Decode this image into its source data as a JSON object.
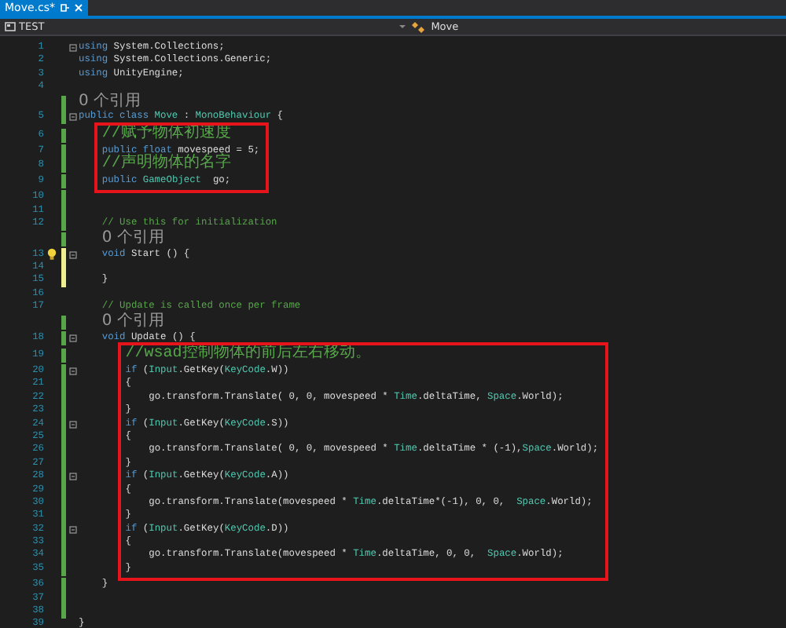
{
  "tabs": [
    {
      "label": "Move.cs*",
      "selected": true
    }
  ],
  "navbar": {
    "project": "TEST",
    "class_name": "Move"
  },
  "blocks": [
    {
      "kind": "plain",
      "lines": [
        {
          "kind": "code",
          "number": "1",
          "fold": true,
          "bulb": false,
          "changed": false,
          "unsaved": false,
          "tokens": [
            {
              "kind": "keyword",
              "text": "using"
            },
            {
              "kind": "plain",
              "text": " System.Collections;"
            }
          ]
        },
        {
          "kind": "code",
          "number": "2",
          "fold": false,
          "bulb": false,
          "changed": false,
          "unsaved": false,
          "tokens": [
            {
              "kind": "keyword",
              "text": "using"
            },
            {
              "kind": "plain",
              "text": " System.Collections.Generic;"
            }
          ]
        },
        {
          "kind": "code",
          "number": "3",
          "fold": false,
          "bulb": false,
          "changed": false,
          "unsaved": false,
          "tokens": [
            {
              "kind": "keyword",
              "text": "using"
            },
            {
              "kind": "plain",
              "text": " UnityEngine;"
            }
          ]
        },
        {
          "kind": "code",
          "number": "4",
          "fold": false,
          "bulb": false,
          "changed": false,
          "unsaved": false
        },
        {
          "kind": "codelens",
          "changed": true,
          "unsaved": false,
          "text": "0 个引用"
        },
        {
          "kind": "code",
          "number": "5",
          "fold": true,
          "bulb": false,
          "changed": true,
          "unsaved": false,
          "tokens": [
            {
              "kind": "keyword",
              "text": "public class "
            },
            {
              "kind": "type",
              "text": "Move"
            },
            {
              "kind": "plain",
              "text": " : "
            },
            {
              "kind": "type",
              "text": "MonoBehaviour"
            },
            {
              "kind": "plain",
              "text": " {"
            }
          ]
        }
      ]
    },
    {
      "kind": "boxed",
      "lines": [
        {
          "kind": "code",
          "number": "6",
          "fold": false,
          "bulb": false,
          "changed": true,
          "unsaved": false,
          "tokens": [
            {
              "kind": "comment",
              "text": "    //赋予物体初速度"
            }
          ]
        },
        {
          "kind": "code",
          "number": "7",
          "fold": false,
          "bulb": false,
          "changed": true,
          "unsaved": false,
          "tokens": [
            {
              "kind": "keyword",
              "text": "    public float"
            },
            {
              "kind": "plain",
              "text": " movespeed = 5;"
            }
          ]
        },
        {
          "kind": "code",
          "number": "8",
          "fold": false,
          "bulb": false,
          "changed": true,
          "unsaved": false,
          "tokens": [
            {
              "kind": "comment",
              "text": "    //声明物体的名字"
            }
          ]
        },
        {
          "kind": "code",
          "number": "9",
          "fold": false,
          "bulb": false,
          "changed": true,
          "unsaved": false,
          "tokens": [
            {
              "kind": "keyword",
              "text": "    public "
            },
            {
              "kind": "type",
              "text": "GameObject"
            },
            {
              "kind": "plain",
              "text": "  go;"
            }
          ]
        }
      ]
    },
    {
      "kind": "plain",
      "lines": [
        {
          "kind": "code",
          "number": "10",
          "fold": false,
          "bulb": false,
          "changed": true,
          "unsaved": false
        },
        {
          "kind": "code",
          "number": "11",
          "fold": false,
          "bulb": false,
          "changed": true,
          "unsaved": false
        },
        {
          "kind": "code",
          "number": "12",
          "fold": false,
          "bulb": false,
          "changed": true,
          "unsaved": false,
          "tokens": [
            {
              "kind": "comment",
              "text": "    // Use this for initialization"
            }
          ]
        },
        {
          "kind": "codelens",
          "changed": true,
          "unsaved": false,
          "text": "    0 个引用"
        },
        {
          "kind": "code",
          "number": "13",
          "fold": true,
          "bulb": true,
          "changed": true,
          "unsaved": true,
          "tokens": [
            {
              "kind": "keyword",
              "text": "    void"
            },
            {
              "kind": "plain",
              "text": " Start () {"
            }
          ]
        },
        {
          "kind": "code",
          "number": "14",
          "fold": false,
          "bulb": false,
          "changed": true,
          "unsaved": true
        },
        {
          "kind": "code",
          "number": "15",
          "fold": false,
          "bulb": false,
          "changed": true,
          "unsaved": true,
          "tokens": [
            {
              "kind": "plain",
              "text": "    }"
            }
          ]
        },
        {
          "kind": "code",
          "number": "16",
          "fold": false,
          "bulb": false,
          "changed": false,
          "unsaved": false
        },
        {
          "kind": "code",
          "number": "17",
          "fold": false,
          "bulb": false,
          "changed": false,
          "unsaved": false,
          "tokens": [
            {
              "kind": "comment",
              "text": "    // Update is called once per frame"
            }
          ]
        },
        {
          "kind": "codelens",
          "changed": true,
          "unsaved": false,
          "text": "    0 个引用"
        },
        {
          "kind": "code",
          "number": "18",
          "fold": true,
          "bulb": false,
          "changed": true,
          "unsaved": false,
          "tokens": [
            {
              "kind": "keyword",
              "text": "    void"
            },
            {
              "kind": "plain",
              "text": " Update () {"
            }
          ]
        }
      ]
    },
    {
      "kind": "boxed",
      "lines": [
        {
          "kind": "code",
          "number": "19",
          "fold": false,
          "bulb": false,
          "changed": true,
          "unsaved": false,
          "tokens": [
            {
              "kind": "comment",
              "text": "        //wsad控制物体的前后左右移动。"
            }
          ]
        },
        {
          "kind": "code",
          "number": "20",
          "fold": true,
          "bulb": false,
          "changed": true,
          "unsaved": false,
          "tokens": [
            {
              "kind": "keyword",
              "text": "        if"
            },
            {
              "kind": "plain",
              "text": " ("
            },
            {
              "kind": "type",
              "text": "Input"
            },
            {
              "kind": "plain",
              "text": ".GetKey("
            },
            {
              "kind": "type",
              "text": "KeyCode"
            },
            {
              "kind": "plain",
              "text": ".W))"
            }
          ]
        },
        {
          "kind": "code",
          "number": "21",
          "fold": false,
          "bulb": false,
          "changed": true,
          "unsaved": false,
          "tokens": [
            {
              "kind": "plain",
              "text": "        {"
            }
          ]
        },
        {
          "kind": "code",
          "number": "22",
          "fold": false,
          "bulb": false,
          "changed": true,
          "unsaved": false,
          "tokens": [
            {
              "kind": "plain",
              "text": "            go.transform.Translate( 0, 0, movespeed * "
            },
            {
              "kind": "type",
              "text": "Time"
            },
            {
              "kind": "plain",
              "text": ".deltaTime, "
            },
            {
              "kind": "type",
              "text": "Space"
            },
            {
              "kind": "plain",
              "text": ".World);"
            }
          ]
        },
        {
          "kind": "code",
          "number": "23",
          "fold": false,
          "bulb": false,
          "changed": true,
          "unsaved": false,
          "tokens": [
            {
              "kind": "plain",
              "text": "        }"
            }
          ]
        },
        {
          "kind": "code",
          "number": "24",
          "fold": true,
          "bulb": false,
          "changed": true,
          "unsaved": false,
          "tokens": [
            {
              "kind": "keyword",
              "text": "        if"
            },
            {
              "kind": "plain",
              "text": " ("
            },
            {
              "kind": "type",
              "text": "Input"
            },
            {
              "kind": "plain",
              "text": ".GetKey("
            },
            {
              "kind": "type",
              "text": "KeyCode"
            },
            {
              "kind": "plain",
              "text": ".S))"
            }
          ]
        },
        {
          "kind": "code",
          "number": "25",
          "fold": false,
          "bulb": false,
          "changed": true,
          "unsaved": false,
          "tokens": [
            {
              "kind": "plain",
              "text": "        {"
            }
          ]
        },
        {
          "kind": "code",
          "number": "26",
          "fold": false,
          "bulb": false,
          "changed": true,
          "unsaved": false,
          "tokens": [
            {
              "kind": "plain",
              "text": "            go.transform.Translate( 0, 0, movespeed * "
            },
            {
              "kind": "type",
              "text": "Time"
            },
            {
              "kind": "plain",
              "text": ".deltaTime * (-1),"
            },
            {
              "kind": "type",
              "text": "Space"
            },
            {
              "kind": "plain",
              "text": ".World);"
            }
          ]
        },
        {
          "kind": "code",
          "number": "27",
          "fold": false,
          "bulb": false,
          "changed": true,
          "unsaved": false,
          "tokens": [
            {
              "kind": "plain",
              "text": "        }"
            }
          ]
        },
        {
          "kind": "code",
          "number": "28",
          "fold": true,
          "bulb": false,
          "changed": true,
          "unsaved": false,
          "tokens": [
            {
              "kind": "keyword",
              "text": "        if"
            },
            {
              "kind": "plain",
              "text": " ("
            },
            {
              "kind": "type",
              "text": "Input"
            },
            {
              "kind": "plain",
              "text": ".GetKey("
            },
            {
              "kind": "type",
              "text": "KeyCode"
            },
            {
              "kind": "plain",
              "text": ".A))"
            }
          ]
        },
        {
          "kind": "code",
          "number": "29",
          "fold": false,
          "bulb": false,
          "changed": true,
          "unsaved": false,
          "tokens": [
            {
              "kind": "plain",
              "text": "        {"
            }
          ]
        },
        {
          "kind": "code",
          "number": "30",
          "fold": false,
          "bulb": false,
          "changed": true,
          "unsaved": false,
          "tokens": [
            {
              "kind": "plain",
              "text": "            go.transform.Translate(movespeed * "
            },
            {
              "kind": "type",
              "text": "Time"
            },
            {
              "kind": "plain",
              "text": ".deltaTime*(-1), 0, 0,  "
            },
            {
              "kind": "type",
              "text": "Space"
            },
            {
              "kind": "plain",
              "text": ".World);"
            }
          ]
        },
        {
          "kind": "code",
          "number": "31",
          "fold": false,
          "bulb": false,
          "changed": true,
          "unsaved": false,
          "tokens": [
            {
              "kind": "plain",
              "text": "        }"
            }
          ]
        },
        {
          "kind": "code",
          "number": "32",
          "fold": true,
          "bulb": false,
          "changed": true,
          "unsaved": false,
          "tokens": [
            {
              "kind": "keyword",
              "text": "        if"
            },
            {
              "kind": "plain",
              "text": " ("
            },
            {
              "kind": "type",
              "text": "Input"
            },
            {
              "kind": "plain",
              "text": ".GetKey("
            },
            {
              "kind": "type",
              "text": "KeyCode"
            },
            {
              "kind": "plain",
              "text": ".D))"
            }
          ]
        },
        {
          "kind": "code",
          "number": "33",
          "fold": false,
          "bulb": false,
          "changed": true,
          "unsaved": false,
          "tokens": [
            {
              "kind": "plain",
              "text": "        {"
            }
          ]
        },
        {
          "kind": "code",
          "number": "34",
          "fold": false,
          "bulb": false,
          "changed": true,
          "unsaved": false,
          "tokens": [
            {
              "kind": "plain",
              "text": "            go.transform.Translate(movespeed * "
            },
            {
              "kind": "type",
              "text": "Time"
            },
            {
              "kind": "plain",
              "text": ".deltaTime, 0, 0,  "
            },
            {
              "kind": "type",
              "text": "Space"
            },
            {
              "kind": "plain",
              "text": ".World);"
            }
          ]
        },
        {
          "kind": "code",
          "number": "35",
          "fold": false,
          "bulb": false,
          "changed": true,
          "unsaved": false,
          "tokens": [
            {
              "kind": "plain",
              "text": "        }"
            }
          ]
        }
      ]
    },
    {
      "kind": "plain",
      "lines": [
        {
          "kind": "code",
          "number": "36",
          "fold": false,
          "bulb": false,
          "changed": true,
          "unsaved": false,
          "tokens": [
            {
              "kind": "plain",
              "text": "    }"
            }
          ]
        },
        {
          "kind": "code",
          "number": "37",
          "fold": false,
          "bulb": false,
          "changed": true,
          "unsaved": false
        },
        {
          "kind": "code",
          "number": "38",
          "fold": false,
          "bulb": false,
          "changed": true,
          "unsaved": false
        },
        {
          "kind": "code",
          "number": "39",
          "fold": false,
          "bulb": false,
          "changed": false,
          "unsaved": false,
          "tokens": [
            {
              "kind": "plain",
              "text": "}"
            }
          ]
        }
      ]
    }
  ]
}
